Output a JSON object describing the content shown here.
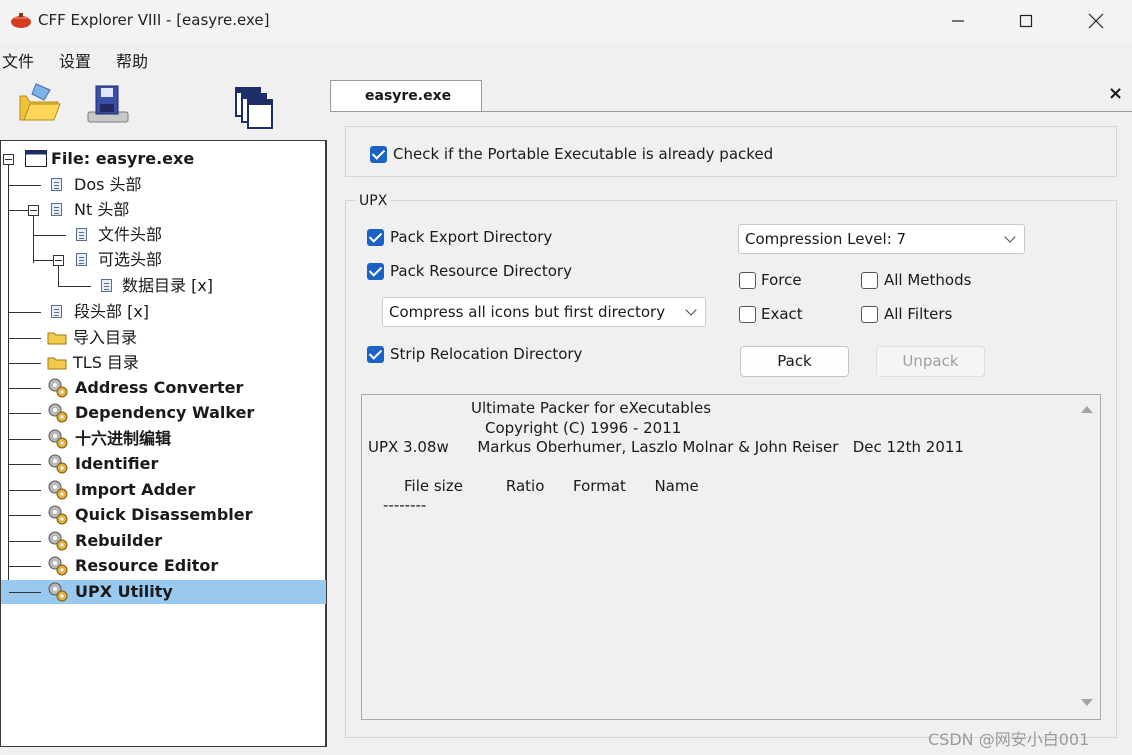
{
  "window": {
    "title": "CFF Explorer VIII - [easyre.exe]",
    "accent_color": "#1a62c6",
    "selection_color": "#99c9ef"
  },
  "menu": {
    "items": [
      "文件",
      "设置",
      "帮助"
    ]
  },
  "toolbar": {
    "buttons": [
      "open-folder-icon",
      "save-disk-icon",
      "windows-stack-icon"
    ]
  },
  "tree": {
    "items": [
      {
        "label": "File: easyre.exe",
        "icon": "window-icon",
        "bold": true
      },
      {
        "label": "Dos 头部",
        "icon": "doc-icon"
      },
      {
        "label": "Nt 头部",
        "icon": "doc-icon"
      },
      {
        "label": "文件头部",
        "icon": "doc-icon"
      },
      {
        "label": "可选头部",
        "icon": "doc-icon"
      },
      {
        "label": "数据目录 [x]",
        "icon": "doc-icon"
      },
      {
        "label": "段头部 [x]",
        "icon": "doc-icon"
      },
      {
        "label": "导入目录",
        "icon": "folder-icon"
      },
      {
        "label": "TLS 目录",
        "icon": "folder-icon"
      },
      {
        "label": "Address Converter",
        "icon": "gear-icon",
        "bold": true
      },
      {
        "label": "Dependency Walker",
        "icon": "gear-icon",
        "bold": true
      },
      {
        "label": "十六进制编辑",
        "icon": "gear-icon",
        "bold": true
      },
      {
        "label": "Identifier",
        "icon": "gear-icon",
        "bold": true
      },
      {
        "label": "Import Adder",
        "icon": "gear-icon",
        "bold": true
      },
      {
        "label": "Quick Disassembler",
        "icon": "gear-icon",
        "bold": true
      },
      {
        "label": "Rebuilder",
        "icon": "gear-icon",
        "bold": true
      },
      {
        "label": "Resource Editor",
        "icon": "gear-icon",
        "bold": true
      },
      {
        "label": "UPX Utility",
        "icon": "gear-icon",
        "bold": true,
        "selected": true
      }
    ]
  },
  "tab": {
    "label": "easyre.exe",
    "close": "×"
  },
  "upx": {
    "check_packed_label": "Check if the Portable Executable is already packed",
    "check_packed_checked": true,
    "group_label": "UPX",
    "pack_export_label": "Pack Export Directory",
    "pack_export_checked": true,
    "pack_resource_label": "Pack Resource Directory",
    "pack_resource_checked": true,
    "icons_option": "Compress all icons but first directory",
    "strip_reloc_label": "Strip Relocation Directory",
    "strip_reloc_checked": true,
    "compression_level": "Compression Level: 7",
    "force_label": "Force",
    "force_checked": false,
    "exact_label": "Exact",
    "exact_checked": false,
    "all_methods_label": "All Methods",
    "all_methods_checked": false,
    "all_filters_label": "All Filters",
    "all_filters_checked": false,
    "pack_button": "Pack",
    "unpack_button": "Unpack",
    "unpack_enabled": false
  },
  "output": {
    "lines": [
      "Ultimate Packer for eXecutables",
      "Copyright (C) 1996 - 2011",
      "UPX 3.08w      Markus Oberhumer, Laszlo Molnar & John Reiser   Dec 12th 2011",
      "File size         Ratio      Format      Name",
      "--------"
    ]
  },
  "watermark": "CSDN @网安小白001"
}
